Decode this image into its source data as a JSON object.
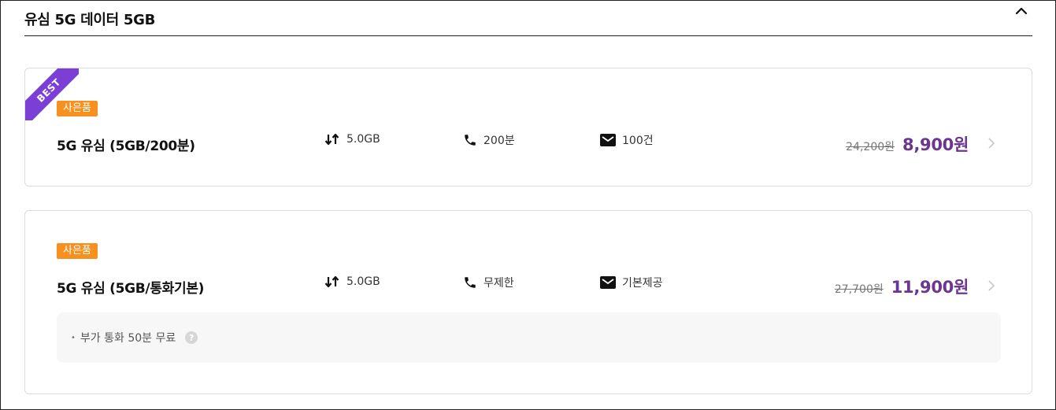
{
  "section": {
    "title": "유심 5G 데이터 5GB"
  },
  "plans": [
    {
      "ribbon": "BEST",
      "gift_badge": "사은품",
      "name": "5G 유심 (5GB/200분)",
      "data": "5.0GB",
      "voice": "200분",
      "sms": "100건",
      "old_price": "24,200원",
      "price": "8,900원"
    },
    {
      "gift_badge": "사은품",
      "name": "5G 유심 (5GB/통화기본)",
      "data": "5.0GB",
      "voice": "무제한",
      "sms": "기본제공",
      "old_price": "27,700원",
      "price": "11,900원",
      "benefit": "부가 통화 50분 무료",
      "benefit_help": "?"
    }
  ],
  "icons": {
    "collapse": "chevron-up-icon",
    "data": "data-transfer-arrows-icon",
    "voice": "phone-icon",
    "sms": "mail-icon",
    "go": "chevron-right-icon",
    "help": "question-circle-icon"
  },
  "colors": {
    "accent_purple": "#6b3590",
    "ribbon_purple": "#7b3fd6",
    "badge_orange": "#f7901e"
  }
}
